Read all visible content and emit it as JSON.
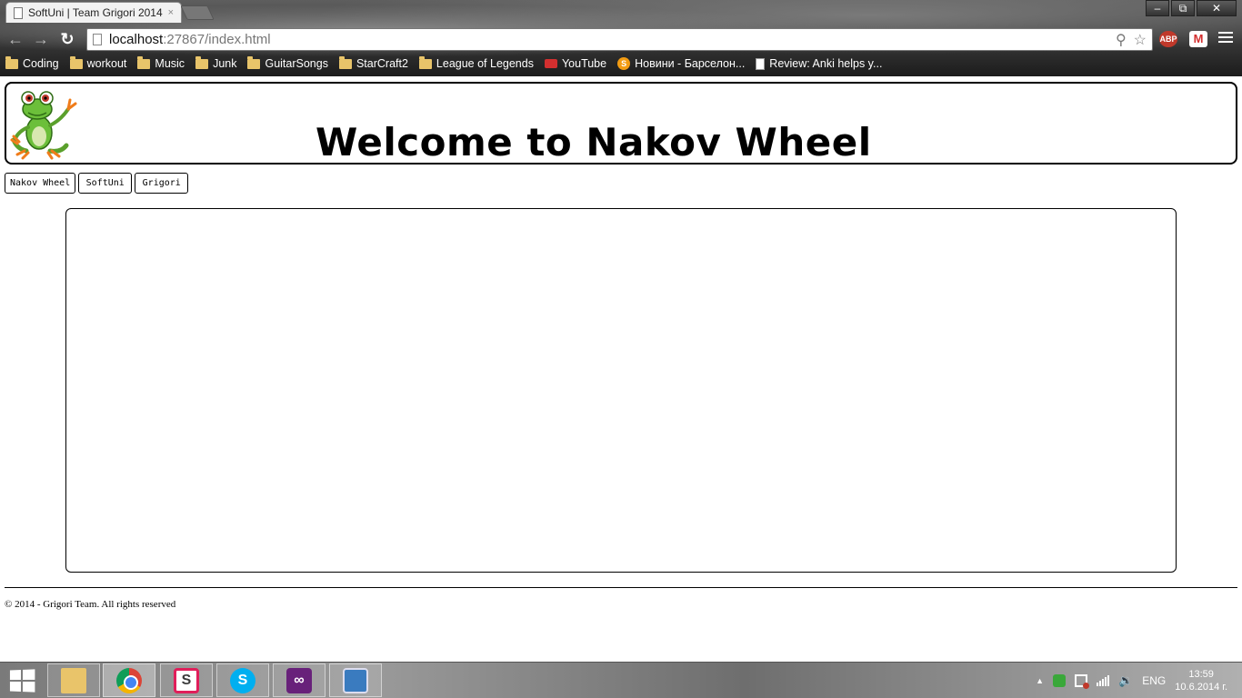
{
  "browser": {
    "tab_title": "SoftUni | Team Grigori 2014",
    "tab_close": "×",
    "window_controls": {
      "minimize": "–",
      "restore": "⧉",
      "close": "✕"
    },
    "url_host": "localhost",
    "url_rest": ":27867/index.html",
    "extensions": {
      "abp": "ABP",
      "gmail": "M"
    },
    "bookmarks": [
      {
        "label": "Coding",
        "icon": "folder-icon"
      },
      {
        "label": "workout",
        "icon": "folder-icon"
      },
      {
        "label": "Music",
        "icon": "folder-icon"
      },
      {
        "label": "Junk",
        "icon": "folder-icon"
      },
      {
        "label": "GuitarSongs",
        "icon": "folder-icon"
      },
      {
        "label": "StarCraft2",
        "icon": "folder-icon"
      },
      {
        "label": "League of Legends",
        "icon": "folder-icon"
      },
      {
        "label": "YouTube",
        "icon": "youtube-icon"
      },
      {
        "label": "Новини - Барселон...",
        "icon": "sport-icon"
      },
      {
        "label": "Review: Anki helps y...",
        "icon": "document-icon"
      }
    ]
  },
  "page": {
    "title": "Welcome to Nakov Wheel",
    "nav": [
      "Nakov Wheel",
      "SoftUni",
      "Grigori"
    ],
    "footer": "© 2014 - Grigori Team. All rights reserved"
  },
  "taskbar": {
    "apps": [
      "file-explorer",
      "google-chrome",
      "slack",
      "skype",
      "visual-studio",
      "photos"
    ],
    "language": "ENG",
    "time": "13:59",
    "date": "10.6.2014 г."
  },
  "colors": {
    "page_background": "#ffffff",
    "border": "#000000",
    "chrome_dark": "#1c1c1c"
  }
}
